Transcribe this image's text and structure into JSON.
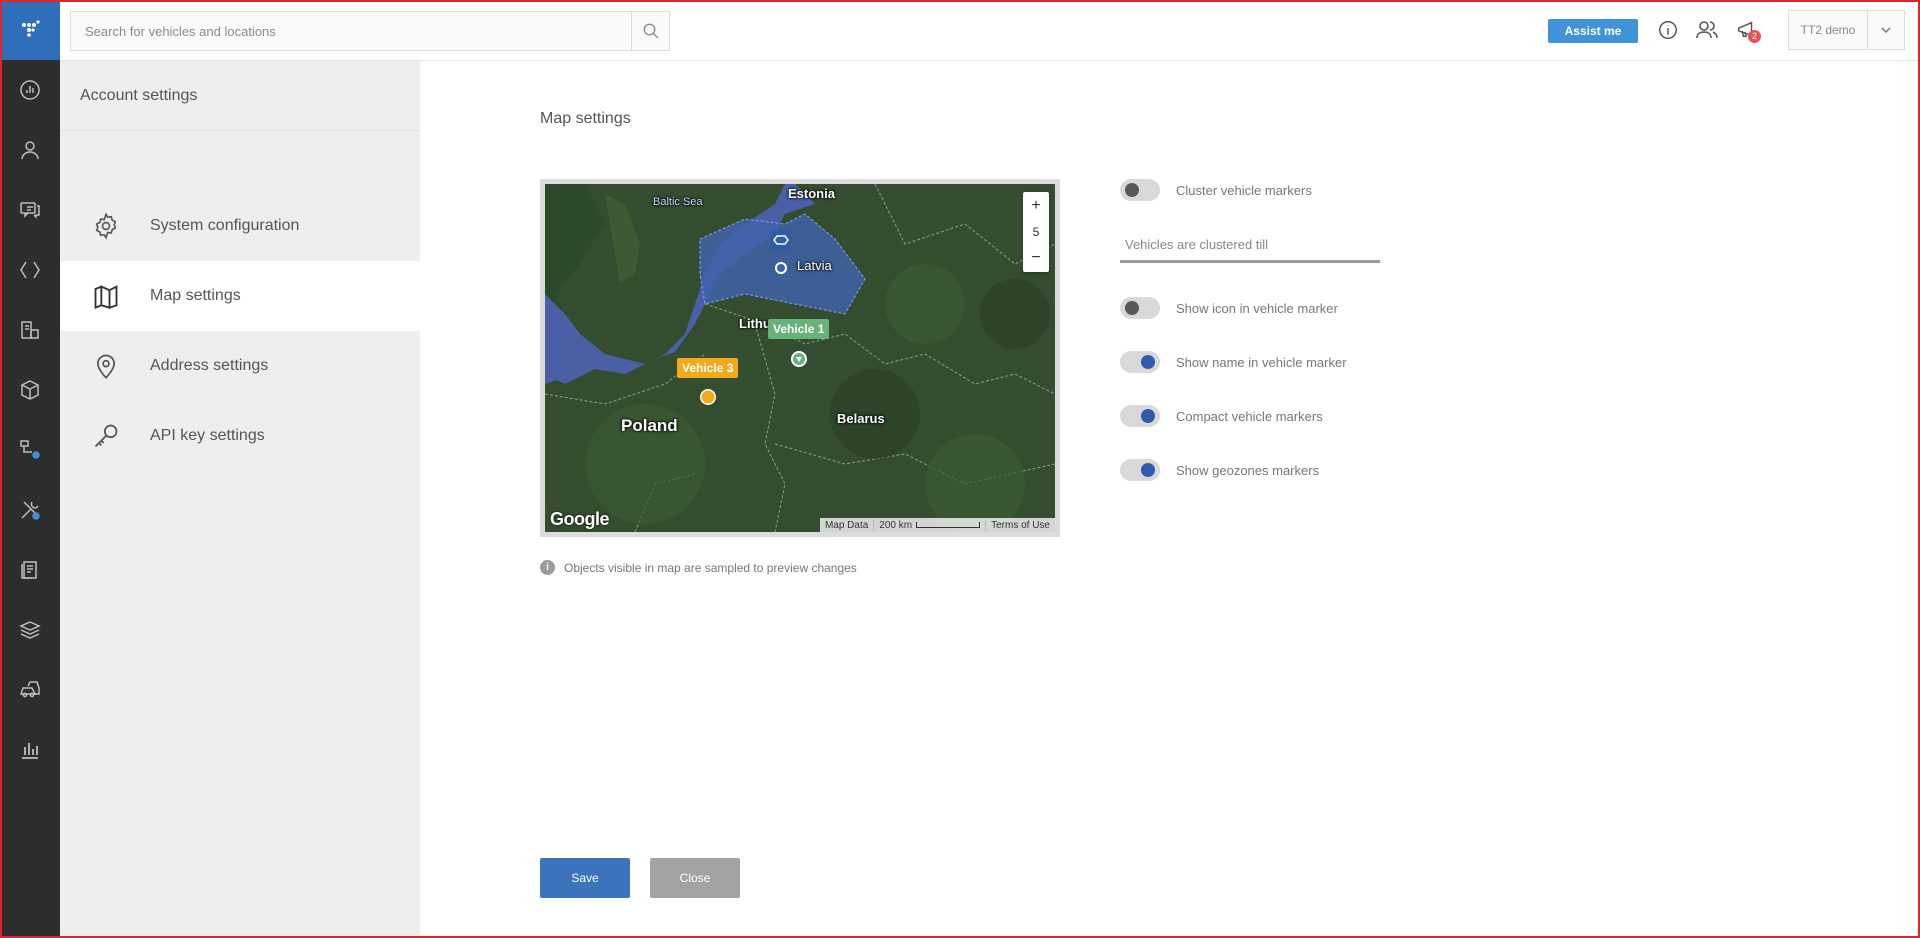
{
  "colors": {
    "accent": "#3c73bd",
    "assist": "#3f93d6",
    "rail_bg": "#2d2d2d",
    "logo_bg": "#2f6fba",
    "toggle_on": "#2f5ba8",
    "toggle_off": "#595959",
    "vehicle1": "#67b27a",
    "vehicle3": "#f2aa1b",
    "badge": "#e55353"
  },
  "rail": {
    "icons": [
      "logo-icon",
      "dashboard-icon",
      "user-icon",
      "chat-icon",
      "routes-icon",
      "documents-icon",
      "package-icon",
      "settings-flow-icon",
      "tools-icon",
      "reports-icon",
      "layers-icon",
      "vehicles-icon",
      "chart-icon"
    ]
  },
  "topbar": {
    "search_placeholder": "Search for vehicles and locations",
    "assist_label": "Assist me",
    "notification_count": "2",
    "account_name": "TT2 demo"
  },
  "sidebar": {
    "title": "Account settings",
    "items": [
      {
        "label": "System configuration",
        "icon": "gear-icon",
        "active": false
      },
      {
        "label": "Map settings",
        "icon": "map-icon",
        "active": true
      },
      {
        "label": "Address settings",
        "icon": "location-pin-icon",
        "active": false
      },
      {
        "label": "API key settings",
        "icon": "key-icon",
        "active": false
      }
    ]
  },
  "main": {
    "title": "Map settings",
    "map": {
      "zoom_in": "+",
      "zoom_level": "5",
      "zoom_out": "−",
      "labels": {
        "baltic_sea": "Baltic Sea",
        "estonia": "Estonia",
        "latvia": "Latvia",
        "lithuania": "Lithu",
        "poland": "Poland",
        "belarus": "Belarus"
      },
      "vehicles": [
        "Vehicle 1",
        "Vehicle 3"
      ],
      "google": "Google",
      "attribution": {
        "map_data": "Map Data",
        "scale": "200 km",
        "terms": "Terms of Use"
      }
    },
    "note": "Objects visible in map are sampled to preview changes",
    "toggles": [
      {
        "label": "Cluster vehicle markers",
        "on": false
      },
      {
        "label": "Show icon in vehicle marker",
        "on": false
      },
      {
        "label": "Show name in vehicle marker",
        "on": true
      },
      {
        "label": "Compact vehicle markers",
        "on": true
      },
      {
        "label": "Show geozones markers",
        "on": true
      }
    ],
    "cluster_placeholder": "Vehicles are clustered till",
    "save_label": "Save",
    "close_label": "Close"
  }
}
